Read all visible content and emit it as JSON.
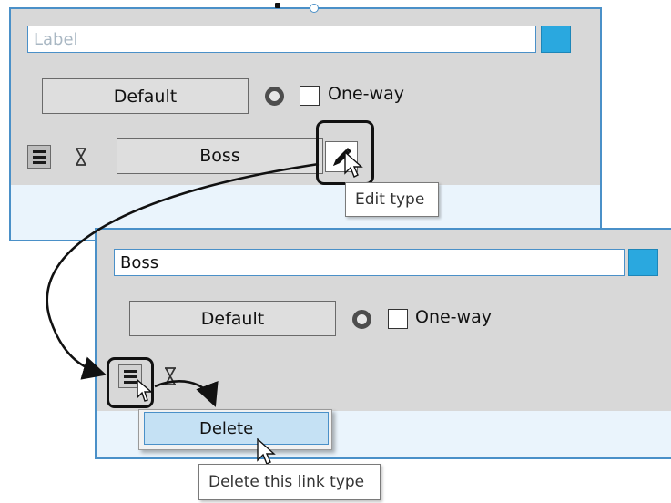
{
  "top_panel": {
    "label_placeholder": "Label",
    "default_button": "Default",
    "one_way_label": "One-way",
    "type_button": "Boss",
    "tooltip": "Edit type"
  },
  "bottom_panel": {
    "label_value": "Boss",
    "default_button": "Default",
    "one_way_label": "One-way"
  },
  "context_menu": {
    "items": [
      {
        "label": "Delete"
      }
    ],
    "tooltip": "Delete this link type"
  },
  "colors": {
    "accent_border": "#4a90c8",
    "swatch": "#2aa8df",
    "panel_background": "#d8d8d8",
    "menu_highlight": "#c5e1f4"
  },
  "icons": [
    "list-icon",
    "hourglass-icon",
    "pencil-icon",
    "radio-icon",
    "checkbox-icon",
    "cursor-icon"
  ]
}
